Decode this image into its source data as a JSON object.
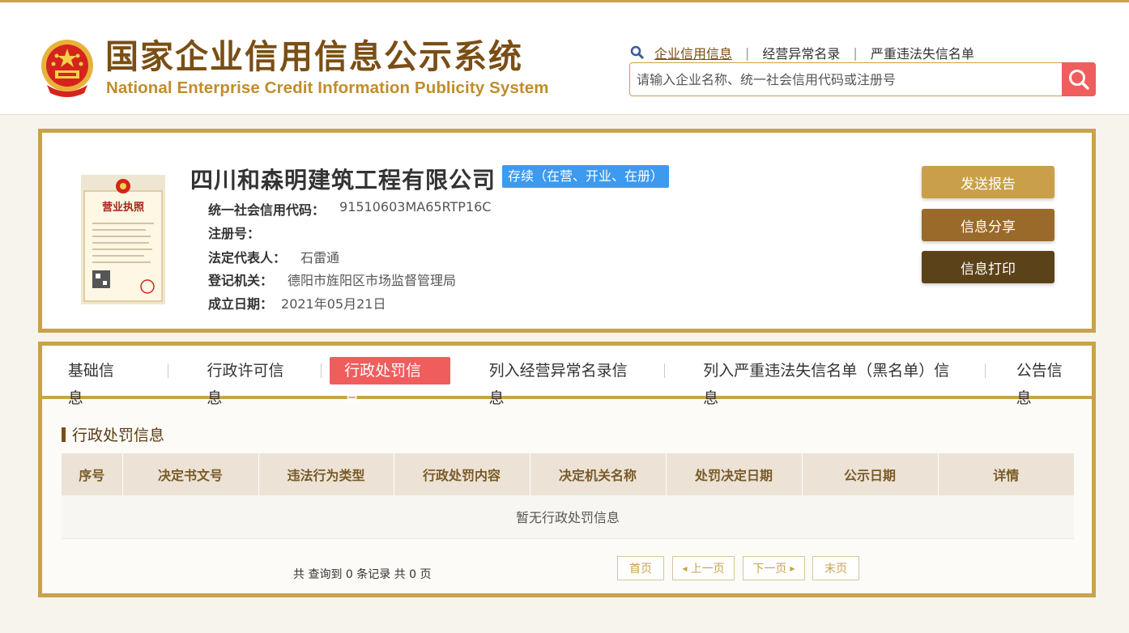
{
  "header": {
    "title_cn": "国家企业信用信息公示系统",
    "title_en": "National Enterprise Credit Information Publicity System",
    "links": [
      "企业信用信息",
      "经营异常名录",
      "严重违法失信名单"
    ],
    "search_placeholder": "请输入企业名称、统一社会信用代码或注册号"
  },
  "company": {
    "name": "四川和森明建筑工程有限公司",
    "status": "存续（在营、开业、在册）",
    "license_title": "营业执照",
    "fields": [
      {
        "key": "统一社会信用代码：",
        "value": "91510603MA65RTP16C"
      },
      {
        "key": "注册号：",
        "value": ""
      },
      {
        "key": "法定代表人：",
        "value": "石雷通"
      },
      {
        "key": "登记机关：",
        "value": "德阳市旌阳区市场监督管理局"
      },
      {
        "key": "成立日期：",
        "value": "2021年05月21日"
      }
    ],
    "actions": [
      "发送报告",
      "信息分享",
      "信息打印"
    ]
  },
  "tabs": [
    "基础信息",
    "行政许可信息",
    "行政处罚信息",
    "列入经营异常名录信息",
    "列入严重违法失信名单（黑名单）信息",
    "公告信息"
  ],
  "active_tab": "行政处罚信息",
  "section": {
    "title": "行政处罚信息",
    "columns": [
      "序号",
      "决定书文号",
      "违法行为类型",
      "行政处罚内容",
      "决定机关名称",
      "处罚决定日期",
      "公示日期",
      "详情"
    ],
    "empty_text": "暂无行政处罚信息"
  },
  "pager": {
    "summary": "共 查询到 0 条记录 共 0 页",
    "first": "首页",
    "prev": "上一页",
    "next": "下一页",
    "last": "末页"
  },
  "colors": {
    "gold": "#c9a249",
    "brown": "#7a4e14",
    "accent_red": "#f05d5d",
    "badge_blue": "#3d9aee",
    "btn_send": "#c9a049",
    "btn_share": "#9a6a2a",
    "btn_print": "#5c4218"
  }
}
